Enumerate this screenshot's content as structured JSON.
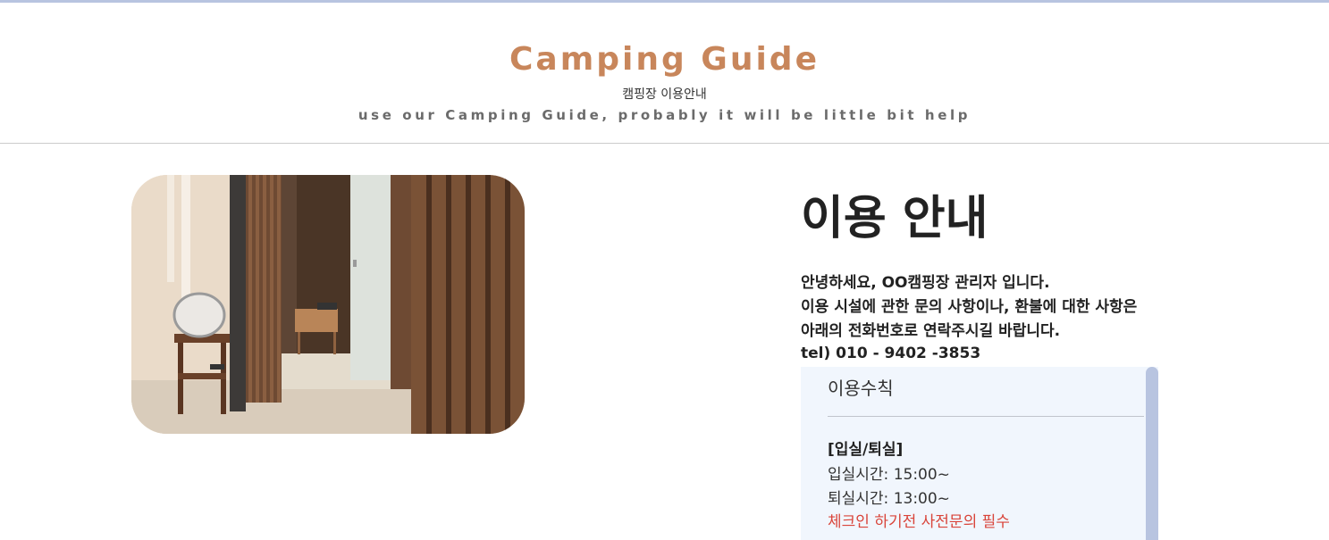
{
  "header": {
    "title": "Camping Guide",
    "subtitle_ko": "캠핑장 이용안내",
    "subtitle_en": "use our Camping Guide, probably it will be little bit help"
  },
  "info": {
    "title": "이용 안내",
    "greeting_lines": [
      "안녕하세요, OO캠핑장 관리자 입니다.",
      "이용 시설에 관한 문의 사항이나, 환불에 대한 사항은",
      "아래의 전화번호로 연락주시길 바랍니다."
    ],
    "tel": "tel) 010 - 9402 -3853"
  },
  "rules": {
    "heading": "이용수칙",
    "section_title": "[입실/퇴실]",
    "items": [
      "입실시간: 15:00~",
      "퇴실시간: 13:00~",
      "체크인 하기전 사전문의 필수"
    ]
  },
  "colors": {
    "accent": "#c8865b",
    "top_bar": "#b8c4e0",
    "rules_bg": "#f1f6fd",
    "warning_text": "#d9443a"
  }
}
